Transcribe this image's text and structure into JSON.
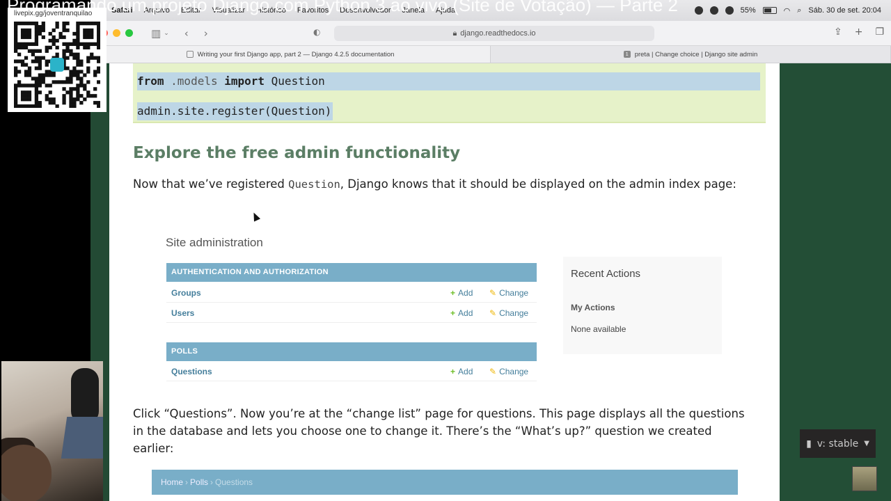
{
  "stream_title": "Programando um projeto Django com Python 3 ao vivo (Site de Votação) — Parte 2",
  "menubar": {
    "app": "Safari",
    "items": [
      "Arquivo",
      "Editar",
      "Visualizar",
      "Histórico",
      "Favoritos",
      "Desenvolvedor",
      "Janela",
      "Ajuda"
    ],
    "battery": "55%",
    "datetime": "Sáb. 30 de set.  20:04"
  },
  "browser": {
    "url": "django.readthedocs.io",
    "tabs": [
      {
        "title": "Writing your first Django app, part 2 — Django 4.2.5 documentation",
        "active": true
      },
      {
        "title": "preta | Change choice | Django site admin",
        "badge": "1",
        "active": false
      }
    ]
  },
  "code_block": {
    "line1": {
      "kw1": "from",
      "module": " .models ",
      "kw2": "import",
      "name": " Question"
    },
    "line2": "admin.site.register(Question)"
  },
  "section": {
    "heading": "Explore the free admin functionality",
    "para1_before": "Now that we’ve registered ",
    "para1_code": "Question",
    "para1_after": ", Django knows that it should be displayed on the admin index page:",
    "para2": "Click “Questions”. Now you’re at the “change list” page for questions. This page displays all the questions in the database and lets you choose one to change it. There’s the “What’s up?” question we created earlier:"
  },
  "admin_shot": {
    "title": "Site administration",
    "modules": [
      {
        "header": "AUTHENTICATION AND AUTHORIZATION",
        "rows": [
          {
            "name": "Groups",
            "add": "Add",
            "change": "Change"
          },
          {
            "name": "Users",
            "add": "Add",
            "change": "Change"
          }
        ]
      },
      {
        "header": "POLLS",
        "rows": [
          {
            "name": "Questions",
            "add": "Add",
            "change": "Change"
          }
        ]
      }
    ],
    "recent": {
      "title": "Recent Actions",
      "my_actions": "My Actions",
      "none": "None available"
    }
  },
  "breadcrumbs": {
    "home": "Home",
    "sep": "›",
    "polls": "Polls",
    "current": "Questions"
  },
  "version_badge": {
    "label": "v: stable",
    "icon": "book-icon"
  },
  "qr": {
    "label": "livepix.gg/joventranquilao"
  },
  "colors": {
    "doc_bg": "#ffffff",
    "page_bg": "#0c3c26",
    "heading": "#5b7e65",
    "module_head": "#79aec8",
    "code_bg": "#e6f2c9"
  }
}
